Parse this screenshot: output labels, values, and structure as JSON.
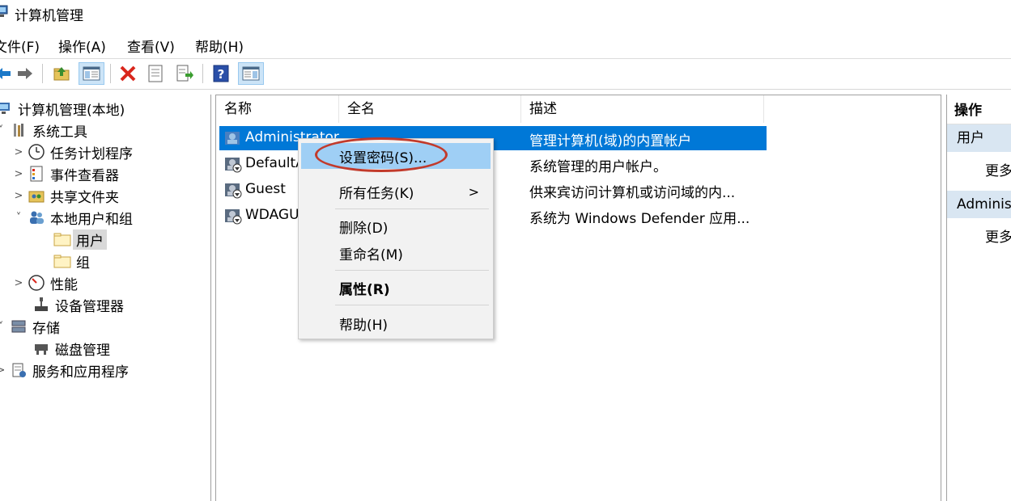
{
  "window": {
    "title": "计算机管理"
  },
  "menu": [
    {
      "label": "文件(F)"
    },
    {
      "label": "操作(A)"
    },
    {
      "label": "查看(V)"
    },
    {
      "label": "帮助(H)"
    }
  ],
  "toolbar": [
    {
      "icon": "back-arrow-icon"
    },
    {
      "icon": "forward-arrow-icon"
    },
    {
      "icon": "up-folder-icon"
    },
    {
      "icon": "show-hide-tree-icon"
    },
    {
      "icon": "delete-icon"
    },
    {
      "icon": "properties-icon"
    },
    {
      "icon": "export-list-icon"
    },
    {
      "icon": "help-icon"
    },
    {
      "icon": "show-action-pane-icon"
    }
  ],
  "tree": [
    {
      "label": "计算机管理(本地)",
      "icon": "computer-management-icon"
    },
    {
      "label": "系统工具",
      "icon": "system-tools-icon"
    },
    {
      "label": "任务计划程序",
      "icon": "clock-icon"
    },
    {
      "label": "事件查看器",
      "icon": "event-viewer-icon"
    },
    {
      "label": "共享文件夹",
      "icon": "shared-folder-icon"
    },
    {
      "label": "本地用户和组",
      "icon": "users-group-icon"
    },
    {
      "label": "用户",
      "icon": "folder-icon"
    },
    {
      "label": "组",
      "icon": "folder-icon"
    },
    {
      "label": "性能",
      "icon": "performance-icon"
    },
    {
      "label": "设备管理器",
      "icon": "device-manager-icon"
    },
    {
      "label": "存储",
      "icon": "storage-icon"
    },
    {
      "label": "磁盘管理",
      "icon": "disk-management-icon"
    },
    {
      "label": "服务和应用程序",
      "icon": "services-icon"
    }
  ],
  "list": {
    "columns": [
      "名称",
      "全名",
      "描述"
    ],
    "rows": [
      {
        "name": "Administrator",
        "fullname": "",
        "description": "管理计算机(域)的内置帐户"
      },
      {
        "name": "DefaultA",
        "fullname": "",
        "description": "系统管理的用户帐户。"
      },
      {
        "name": "Guest",
        "fullname": "",
        "description": "供来宾访问计算机或访问域的内..."
      },
      {
        "name": "WDAGU",
        "fullname": "",
        "description": "系统为 Windows Defender 应用..."
      }
    ]
  },
  "context_menu": {
    "items": [
      {
        "label": "设置密码(S)..."
      },
      {
        "label": "所有任务(K)"
      },
      {
        "label": "删除(D)"
      },
      {
        "label": "重命名(M)"
      },
      {
        "label": "属性(R)"
      },
      {
        "label": "帮助(H)"
      }
    ],
    "submenu_arrow": ">"
  },
  "actions": {
    "header": "操作",
    "sections": [
      {
        "title": "用户",
        "more": "更多"
      },
      {
        "title": "Administ",
        "more": "更多"
      }
    ]
  },
  "colors": {
    "selection": "#0078d7",
    "menu_highlight": "#9fcff5",
    "annotation": "#c23a2b"
  }
}
